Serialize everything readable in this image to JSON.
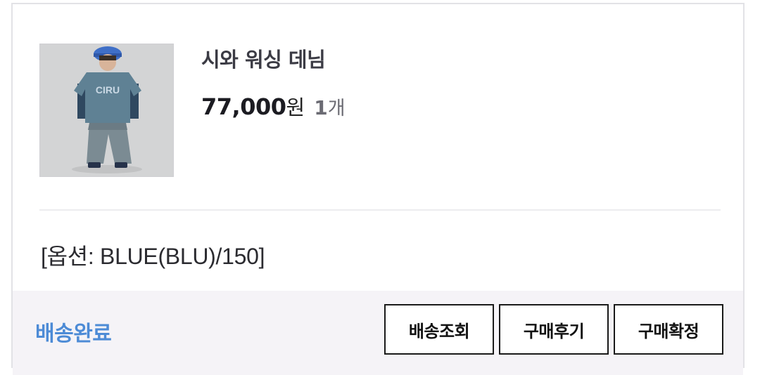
{
  "product": {
    "name": "시와 워싱 데님",
    "price": "77,000",
    "price_unit": "원",
    "quantity": "1",
    "quantity_unit": "개",
    "image_icon": "product-photo"
  },
  "option": {
    "text": "[옵션: BLUE(BLU)/150]"
  },
  "footer": {
    "status": "배송완료",
    "status_color": "#4d8bd6",
    "buttons": {
      "track": "배송조회",
      "review": "구매후기",
      "confirm": "구매확정"
    }
  }
}
